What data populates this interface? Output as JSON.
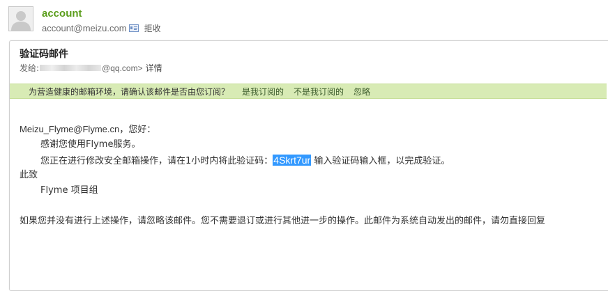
{
  "sender": {
    "name": "account",
    "email": "account@meizu.com",
    "reject_label": "拒收",
    "avatar_icon": "user-silhouette-icon",
    "vcard_icon": "vcard-icon"
  },
  "mail": {
    "subject": "验证码邮件",
    "to_label": "发给:",
    "to_domain": "@qq.com>",
    "detail_label": "详情"
  },
  "notice": {
    "text": "为营造健康的邮箱环境，请确认该邮件是否由您订阅？",
    "subscribed_label": "是我订阅的",
    "not_subscribed_label": "不是我订阅的",
    "ignore_label": "忽略",
    "background_color": "#d8ebb5"
  },
  "body": {
    "greeting_address": "Meizu_Flyme@Flyme.cn",
    "greeting_suffix": "，您好：",
    "line1": "感谢您使用Flyme服务。",
    "line2_prefix": "您正在进行修改安全邮箱操作，请在1小时内将此验证码：",
    "verification_code": "4Skrt7ur",
    "line2_suffix": "输入验证码输入框，以完成验证。",
    "closing": "此致",
    "signature": "Flyme 项目组",
    "footer": "如果您并没有进行上述操作，请忽略该邮件。您不需要退订或进行其他进一步的操作。此邮件为系统自动发出的邮件，请勿直接回复"
  },
  "colors": {
    "sender_name": "#5a9d1b",
    "highlight": "#3399ff"
  }
}
